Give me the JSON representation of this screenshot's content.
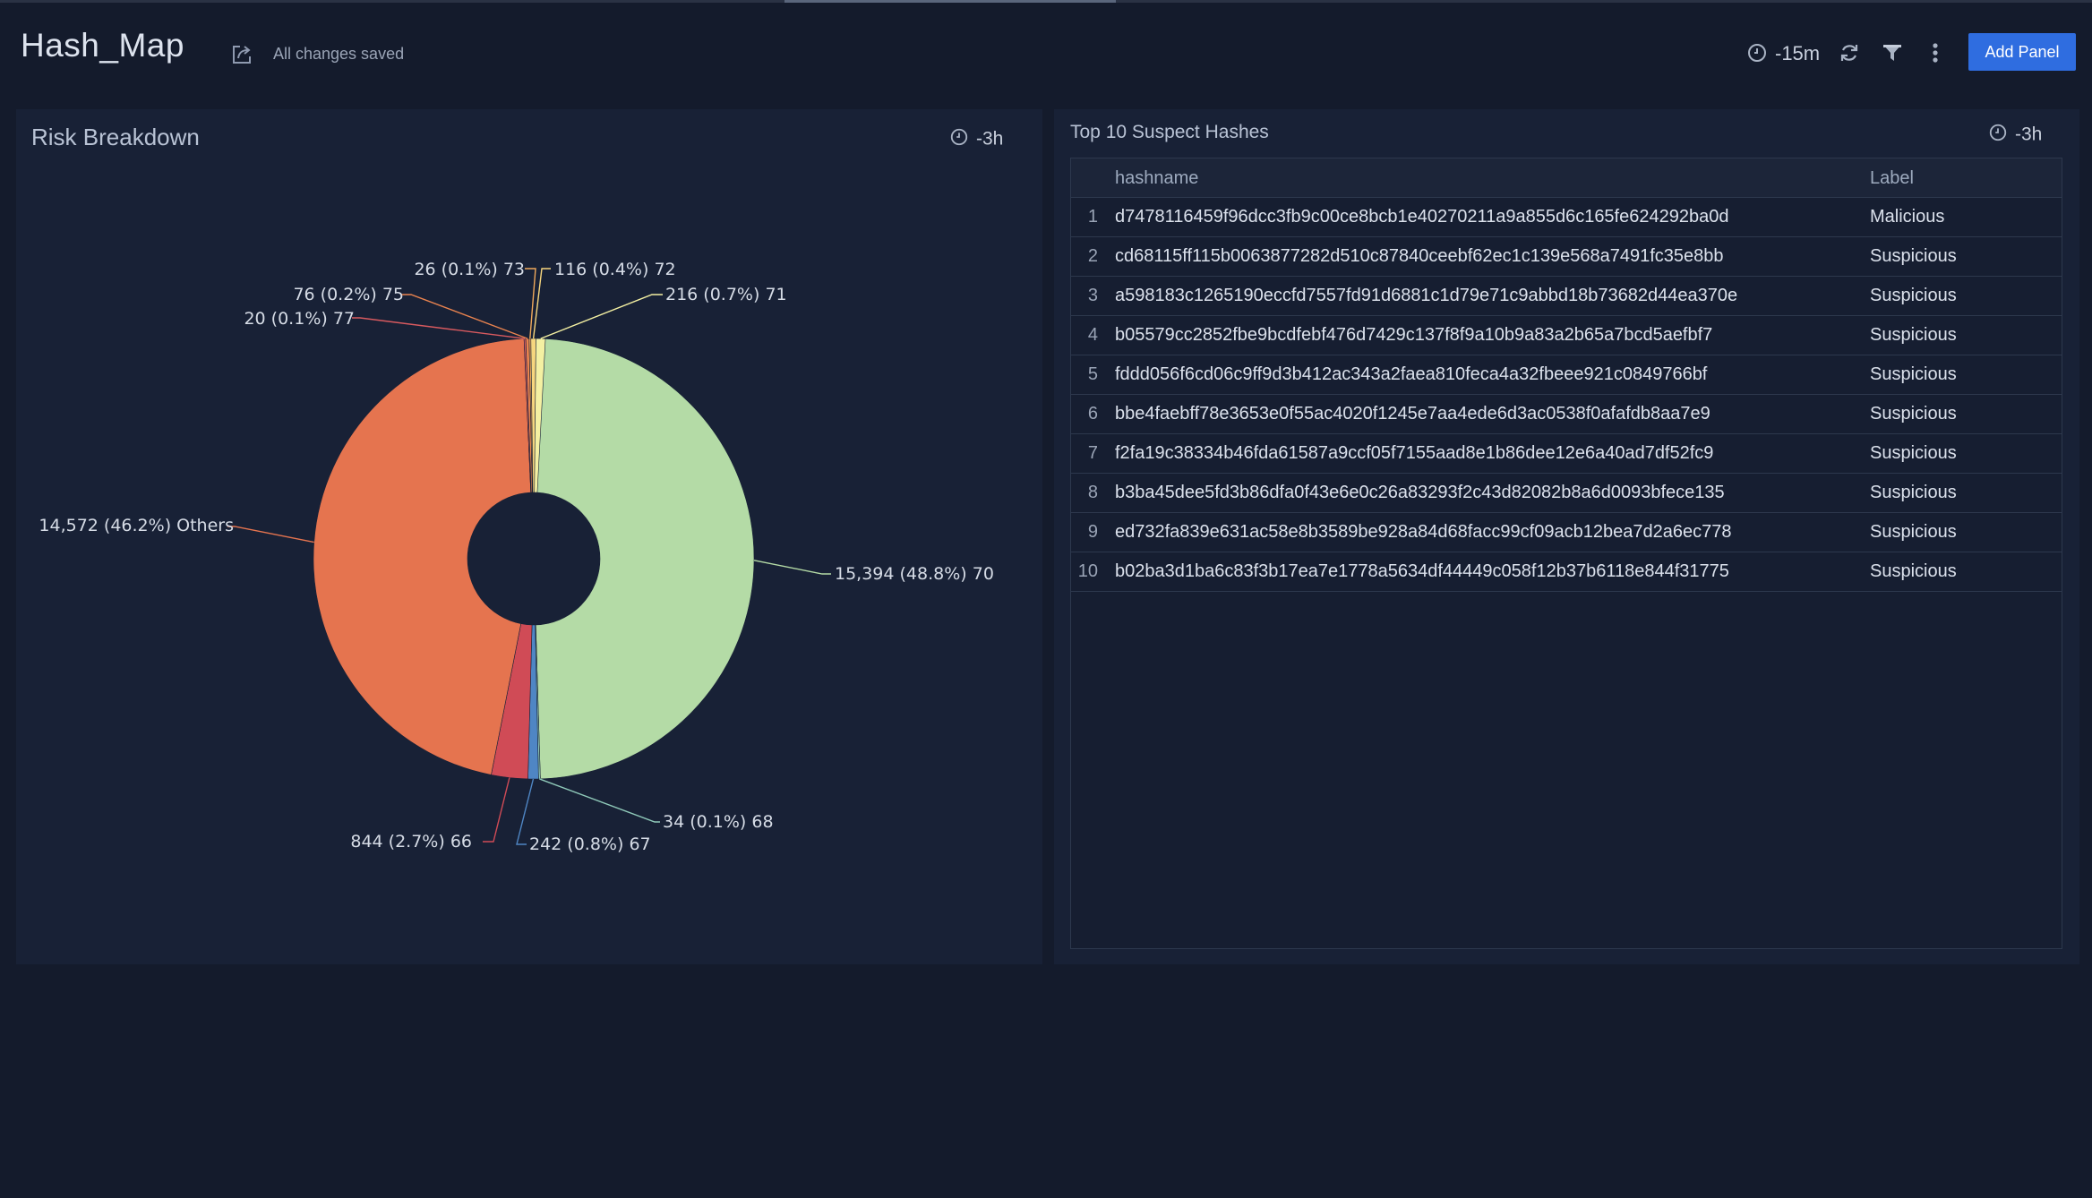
{
  "header": {
    "title": "Hash_Map",
    "saved_status": "All changes saved",
    "time_range": "-15m",
    "add_panel_label": "Add Panel"
  },
  "risk_panel": {
    "title": "Risk Breakdown",
    "time_range": "-3h"
  },
  "hashes_panel": {
    "title": "Top 10 Suspect Hashes",
    "time_range": "-3h",
    "columns": [
      "hashname",
      "Label"
    ],
    "rows": [
      {
        "index": "1",
        "hashname": "d7478116459f96dcc3fb9c00ce8bcb1e40270211a9a855d6c165fe624292ba0d",
        "label": "Malicious"
      },
      {
        "index": "2",
        "hashname": "cd68115ff115b0063877282d510c87840ceebf62ec1c139e568a7491fc35e8bb",
        "label": "Suspicious"
      },
      {
        "index": "3",
        "hashname": "a598183c1265190eccfd7557fd91d6881c1d79e71c9abbd18b73682d44ea370e",
        "label": "Suspicious"
      },
      {
        "index": "4",
        "hashname": "b05579cc2852fbe9bcdfebf476d7429c137f8f9a10b9a83a2b65a7bcd5aefbf7",
        "label": "Suspicious"
      },
      {
        "index": "5",
        "hashname": "fddd056f6cd06c9ff9d3b412ac343a2faea810feca4a32fbeee921c0849766bf",
        "label": "Suspicious"
      },
      {
        "index": "6",
        "hashname": "bbe4faebff78e3653e0f55ac4020f1245e7aa4ede6d3ac0538f0afafdb8aa7e9",
        "label": "Suspicious"
      },
      {
        "index": "7",
        "hashname": "f2fa19c38334b46fda61587a9ccf05f7155aad8e1b86dee12e6a40ad7df52fc9",
        "label": "Suspicious"
      },
      {
        "index": "8",
        "hashname": "b3ba45dee5fd3b86dfa0f43e6e0c26a83293f2c43d82082b8a6d0093bfece135",
        "label": "Suspicious"
      },
      {
        "index": "9",
        "hashname": "ed732fa839e631ac58e8b3589be928a84d68facc99cf09acb12bea7d2a6ec778",
        "label": "Suspicious"
      },
      {
        "index": "10",
        "hashname": "b02ba3d1ba6c83f3b17ea7e1778a5634df44449c058f12b37b6118e844f31775",
        "label": "Suspicious"
      }
    ]
  },
  "chart_data": {
    "type": "pie",
    "donut": true,
    "title": "",
    "slices": [
      {
        "name": "70",
        "value": 15394,
        "label": "15,394 (48.8%) 70",
        "color": "#b4dba6"
      },
      {
        "name": "68",
        "value": 34,
        "label": "34 (0.1%) 68",
        "color": "#8fc9b9"
      },
      {
        "name": "67",
        "value": 242,
        "label": "242 (0.8%) 67",
        "color": "#4f86c4"
      },
      {
        "name": "66",
        "value": 844,
        "label": "844 (2.7%) 66",
        "color": "#d04b56"
      },
      {
        "name": "Others",
        "value": 14572,
        "label": "14,572 (46.2%) Others",
        "color": "#e5744f"
      },
      {
        "name": "77",
        "value": 20,
        "label": "20 (0.1%) 77",
        "color": "#d85a5f"
      },
      {
        "name": "75",
        "value": 76,
        "label": "76 (0.2%) 75",
        "color": "#e9834f"
      },
      {
        "name": "73",
        "value": 26,
        "label": "26 (0.1%) 73",
        "color": "#f0a95b"
      },
      {
        "name": "72",
        "value": 116,
        "label": "116 (0.4%) 72",
        "color": "#f7d67e"
      },
      {
        "name": "71",
        "value": 216,
        "label": "216 (0.7%) 71",
        "color": "#f4f0a2"
      }
    ],
    "legend": "none"
  }
}
